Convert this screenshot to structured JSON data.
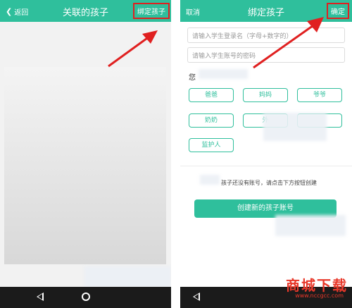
{
  "left_screen": {
    "back_label": "返回",
    "title": "关联的孩子",
    "action_label": "绑定孩子"
  },
  "right_screen": {
    "cancel_label": "取消",
    "title": "绑定孩子",
    "confirm_label": "确定",
    "login_placeholder": "请输入学生登录名（字母+数字的）",
    "password_placeholder": "请输入学生账号的密码",
    "relation_prompt": "您",
    "relations": [
      "爸爸",
      "妈妈",
      "爷爷",
      "奶奶",
      "外",
      "监护人"
    ],
    "no_account_hint": "孩子还没有账号，请点击下方按钮创建",
    "create_button_label": "创建新的孩子账号"
  },
  "watermark": {
    "text": "商城下载",
    "url": "www.nccgcc.com"
  },
  "colors": {
    "accent": "#2fbf9c",
    "highlight": "#e02020"
  }
}
